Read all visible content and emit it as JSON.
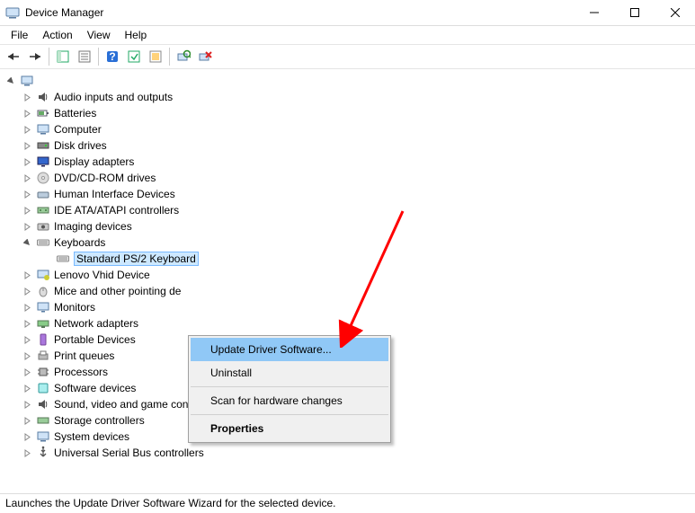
{
  "window": {
    "title": "Device Manager"
  },
  "menubar": {
    "items": [
      "File",
      "Action",
      "View",
      "Help"
    ]
  },
  "tree": {
    "root_expanded": true,
    "categories": [
      {
        "label": "Audio inputs and outputs",
        "expanded": false
      },
      {
        "label": "Batteries",
        "expanded": false
      },
      {
        "label": "Computer",
        "expanded": false
      },
      {
        "label": "Disk drives",
        "expanded": false
      },
      {
        "label": "Display adapters",
        "expanded": false
      },
      {
        "label": "DVD/CD-ROM drives",
        "expanded": false
      },
      {
        "label": "Human Interface Devices",
        "expanded": false
      },
      {
        "label": "IDE ATA/ATAPI controllers",
        "expanded": false
      },
      {
        "label": "Imaging devices",
        "expanded": false
      },
      {
        "label": "Keyboards",
        "expanded": true,
        "children": [
          {
            "label": "Standard PS/2 Keyboard",
            "selected": true
          }
        ]
      },
      {
        "label": "Lenovo Vhid Device",
        "expanded": false
      },
      {
        "label": "Mice and other pointing de",
        "expanded": false
      },
      {
        "label": "Monitors",
        "expanded": false
      },
      {
        "label": "Network adapters",
        "expanded": false
      },
      {
        "label": "Portable Devices",
        "expanded": false
      },
      {
        "label": "Print queues",
        "expanded": false
      },
      {
        "label": "Processors",
        "expanded": false
      },
      {
        "label": "Software devices",
        "expanded": false
      },
      {
        "label": "Sound, video and game controllers",
        "expanded": false
      },
      {
        "label": "Storage controllers",
        "expanded": false
      },
      {
        "label": "System devices",
        "expanded": false
      },
      {
        "label": "Universal Serial Bus controllers",
        "expanded": false
      }
    ]
  },
  "context_menu": {
    "items": [
      {
        "label": "Update Driver Software...",
        "highlighted": true
      },
      {
        "label": "Uninstall"
      },
      {
        "separator": true
      },
      {
        "label": "Scan for hardware changes"
      },
      {
        "separator": true
      },
      {
        "label": "Properties",
        "bold": true
      }
    ]
  },
  "statusbar": {
    "text": "Launches the Update Driver Software Wizard for the selected device."
  }
}
